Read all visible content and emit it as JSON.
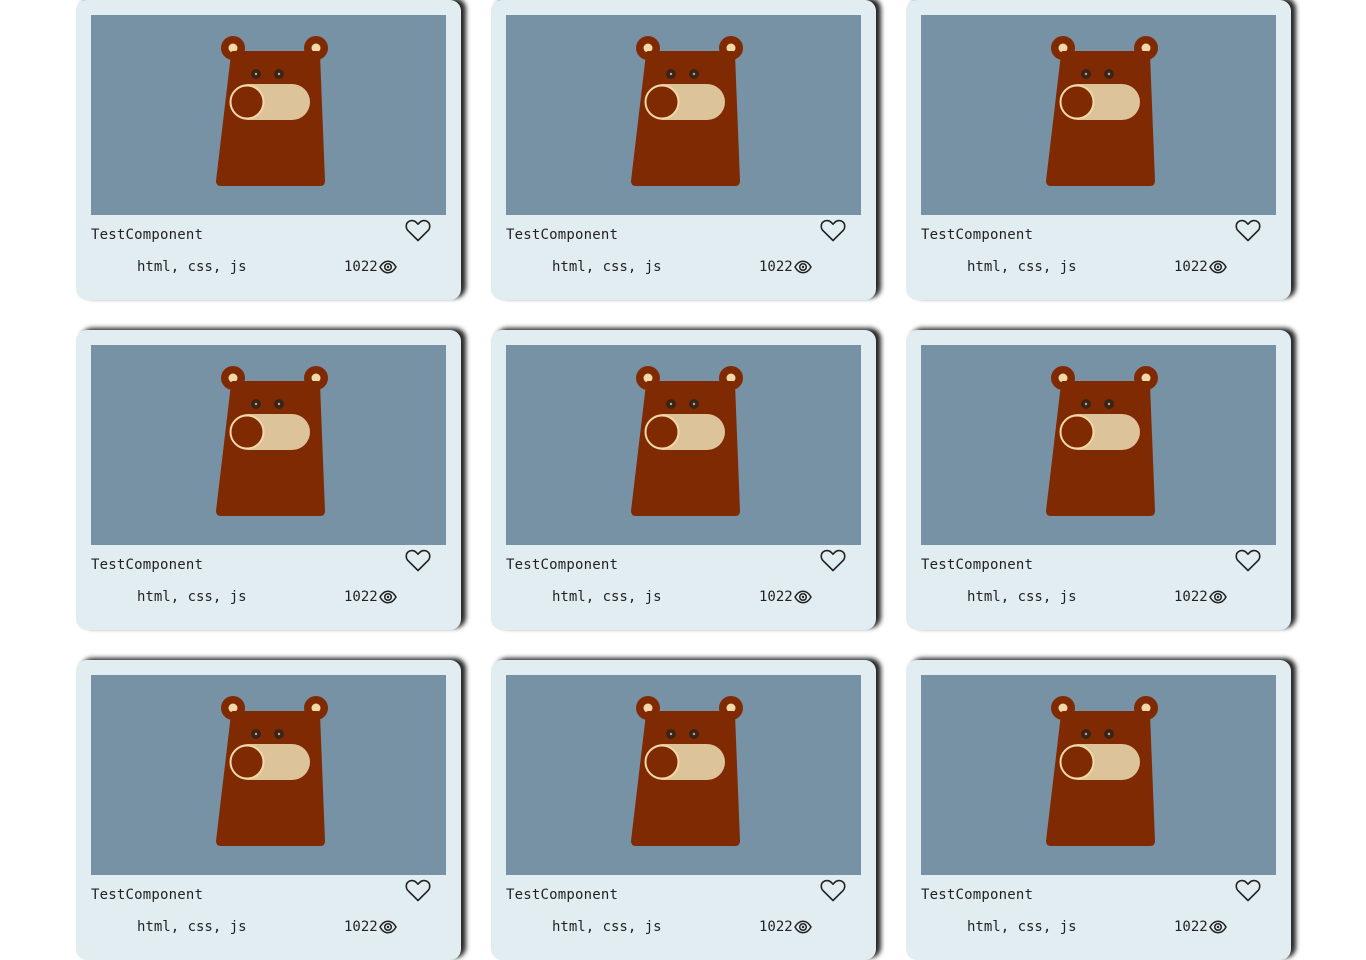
{
  "components": [
    {
      "title": "TestComponent",
      "tags": "html, css, js",
      "views": "1022"
    },
    {
      "title": "TestComponent",
      "tags": "html, css, js",
      "views": "1022"
    },
    {
      "title": "TestComponent",
      "tags": "html, css, js",
      "views": "1022"
    },
    {
      "title": "TestComponent",
      "tags": "html, css, js",
      "views": "1022"
    },
    {
      "title": "TestComponent",
      "tags": "html, css, js",
      "views": "1022"
    },
    {
      "title": "TestComponent",
      "tags": "html, css, js",
      "views": "1022"
    },
    {
      "title": "TestComponent",
      "tags": "html, css, js",
      "views": "1022"
    },
    {
      "title": "TestComponent",
      "tags": "html, css, js",
      "views": "1022"
    },
    {
      "title": "TestComponent",
      "tags": "html, css, js",
      "views": "1022"
    }
  ],
  "icons": {
    "like": "heart-outline-icon",
    "views": "eye-icon"
  },
  "colors": {
    "card_bg": "#e2edf1",
    "preview_bg": "#7892a5",
    "bear_body": "#7f2a03",
    "bear_muzzle": "#dcc39a",
    "bear_ear_inner": "#f2d9a8",
    "bear_eye": "#3a2418"
  }
}
